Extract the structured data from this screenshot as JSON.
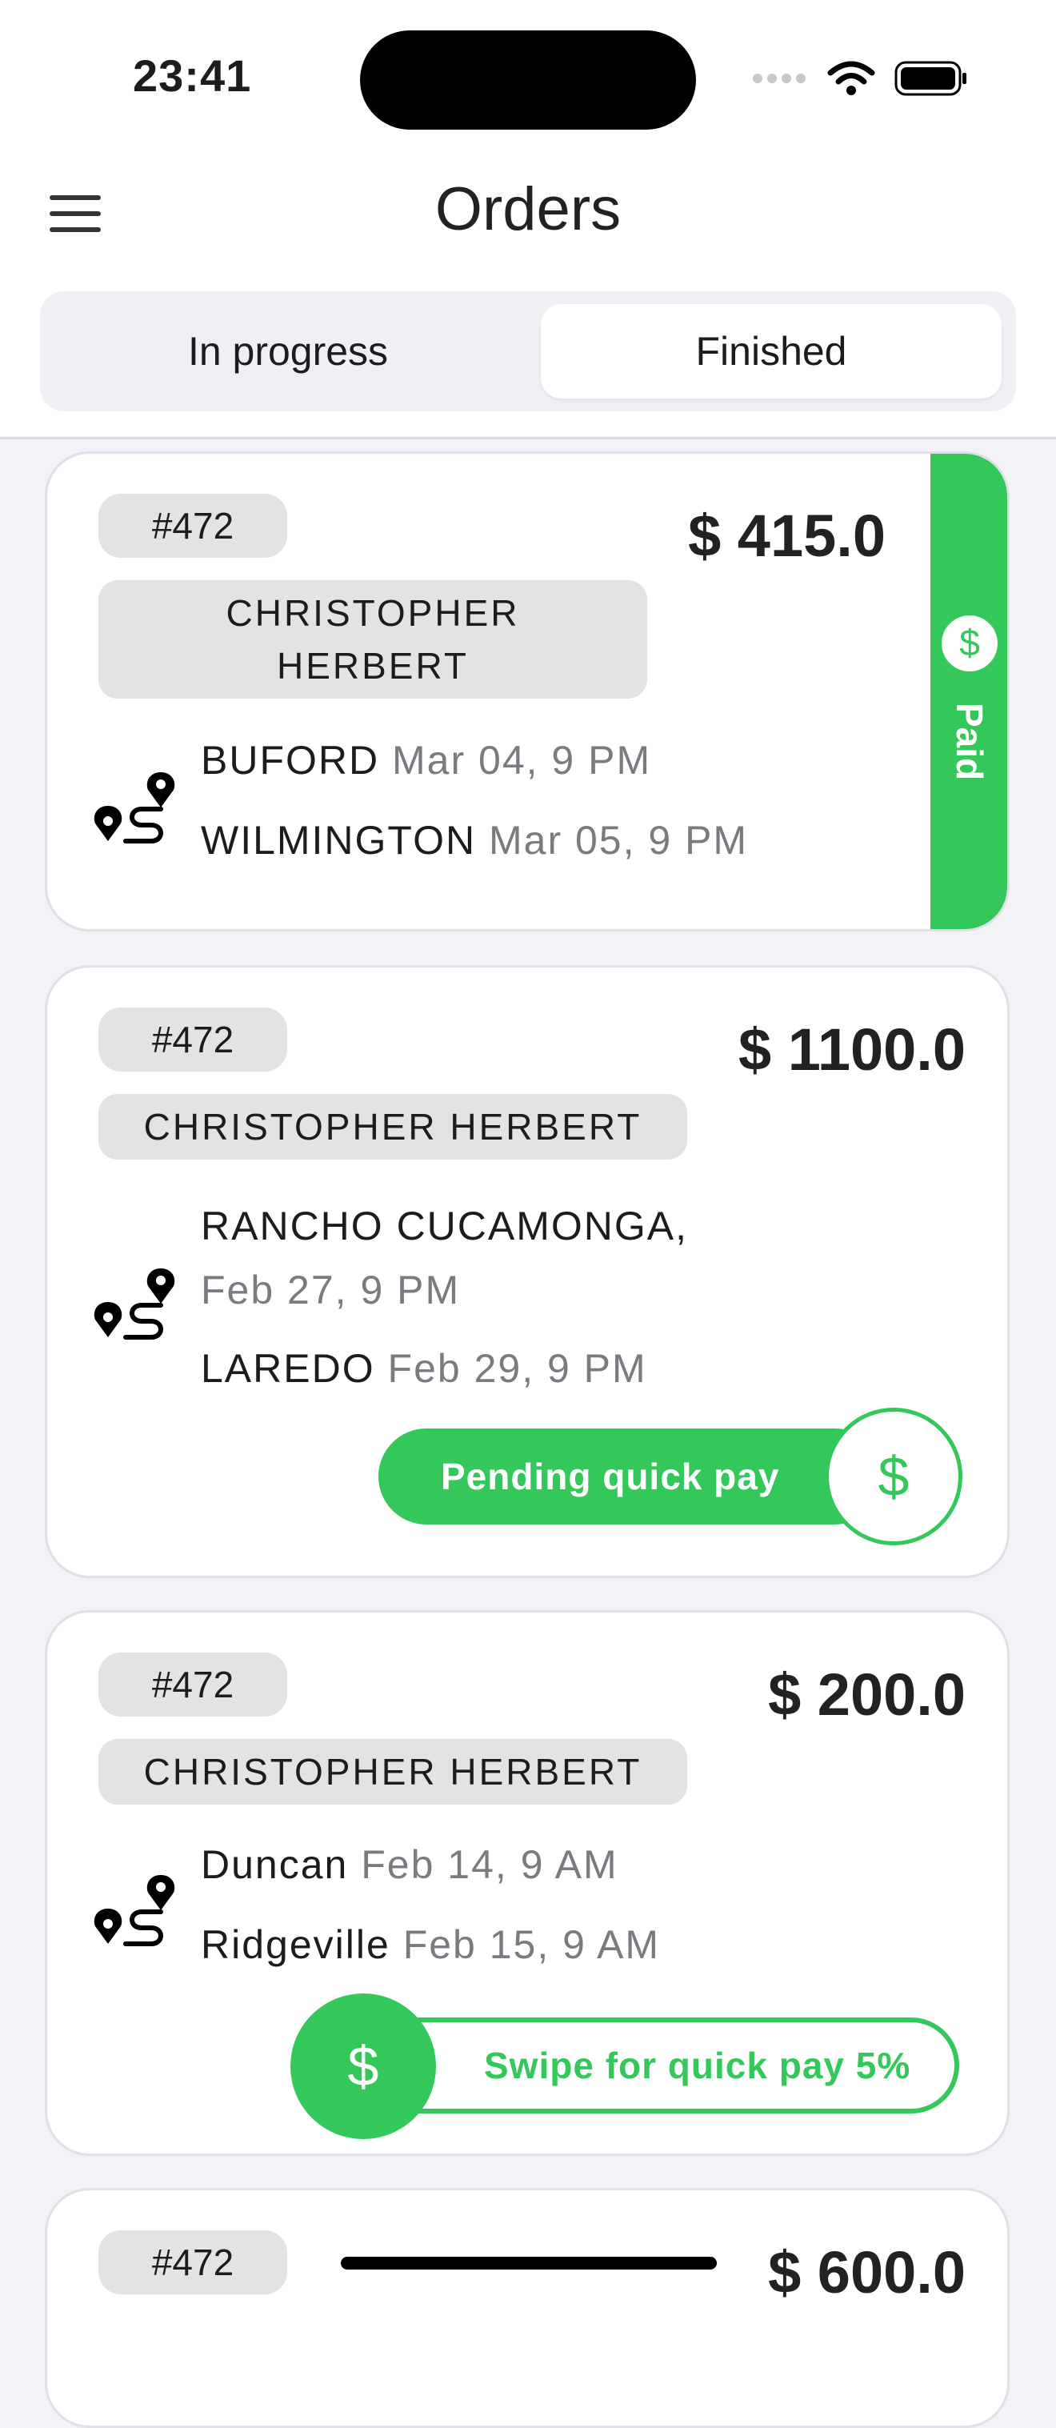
{
  "status_bar": {
    "time": "23:41"
  },
  "header": {
    "title": "Orders"
  },
  "tabs": [
    {
      "label": "In progress",
      "selected": false
    },
    {
      "label": "Finished",
      "selected": true
    }
  ],
  "colors": {
    "accent": "#34c759",
    "chip": "#e3e3e6",
    "muted_text": "#7a7a80"
  },
  "orders": [
    {
      "id": "#472",
      "price": "$ 415.0",
      "customer": "CHRISTOPHER HERBERT",
      "from_city": "BUFORD",
      "from_date": "Mar 04, 9 PM",
      "to_city": "WILMINGTON",
      "to_date": "Mar 05, 9 PM",
      "status_label": "Paid"
    },
    {
      "id": "#472",
      "price": "$ 1100.0",
      "customer": "CHRISTOPHER HERBERT",
      "from_city": "RANCHO CUCAMONGA,",
      "from_date": "Feb 27, 9 PM",
      "to_city": "LAREDO",
      "to_date": "Feb 29, 9 PM",
      "action_label": "Pending quick pay",
      "action_icon": "$"
    },
    {
      "id": "#472",
      "price": "$ 200.0",
      "customer": "CHRISTOPHER HERBERT",
      "from_city": "Duncan",
      "from_date": "Feb 14, 9 AM",
      "to_city": "Ridgeville",
      "to_date": "Feb 15, 9 AM",
      "action_label": "Swipe for quick pay 5%",
      "action_icon": "$"
    },
    {
      "id": "#472",
      "price": "$ 600.0"
    }
  ]
}
